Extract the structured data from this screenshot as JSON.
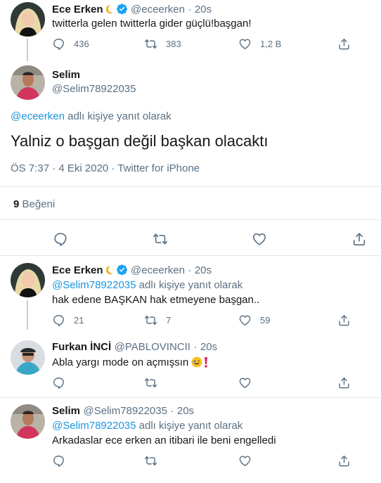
{
  "tweet1": {
    "name": "Ece Erken",
    "handle": "@eceerken",
    "dot": "·",
    "time": "20s",
    "text": "twitterla gelen twitterla gider güçlü!başgan!",
    "replies": "436",
    "retweets": "383",
    "likes": "1,2 B"
  },
  "main": {
    "name": "Selim",
    "handle": "@Selim78922035",
    "reply_mention": "@eceerken",
    "reply_suffix": " adlı kişiye yanıt olarak",
    "text": "Yalniz o başgan değil başkan olacaktı",
    "timestamp": "ÖS 7:37 · 4 Eki 2020 · Twitter for iPhone",
    "likes_count": "9",
    "likes_label": " Beğeni"
  },
  "reply1": {
    "name": "Ece Erken",
    "handle": "@eceerken",
    "dot": "·",
    "time": "20s",
    "reply_mention": "@Selim78922035",
    "reply_suffix": " adlı kişiye yanıt olarak",
    "text": "hak edene BAŞKAN hak etmeyene başgan..",
    "replies": "21",
    "retweets": "7",
    "likes": "59"
  },
  "reply2": {
    "name": "Furkan İNCİ",
    "handle": "@PABLOVINCII",
    "dot": "·",
    "time": "20s",
    "text": "Abla yargı mode on açmışsın "
  },
  "reply3": {
    "name": "Selim",
    "handle": "@Selim78922035",
    "dot": "·",
    "time": "20s",
    "reply_mention": "@Selim78922035",
    "reply_suffix": " adlı kişiye yanıt olarak",
    "text": "Arkadaslar ece erken an itibari ile beni engelledi"
  },
  "icons": {
    "reply": "reply-icon",
    "retweet": "retweet-icon",
    "like": "heart-icon",
    "share": "share-icon",
    "verified": "verified-badge-icon",
    "moon": "crescent-moon-icon"
  },
  "colors": {
    "accent": "#1b95e0",
    "muted": "#5b7083",
    "divider": "#e1e8ed",
    "verified": "#1da1f2"
  }
}
